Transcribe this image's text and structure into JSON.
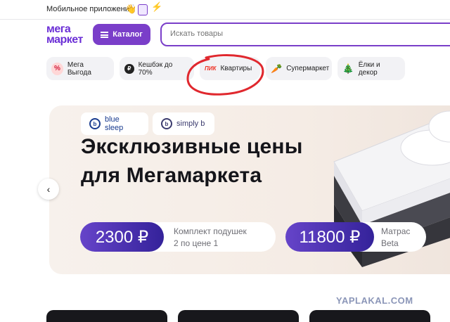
{
  "topbar": {
    "mobile_app_label": "Мобильное приложение",
    "icons": [
      "sparkle-hand-icon",
      "shopping-bag-icon",
      "lightning-icon"
    ]
  },
  "header": {
    "logo_line1": "мега",
    "logo_line2": "маркет",
    "catalog_label": "Каталог",
    "search_placeholder": "Искать товары"
  },
  "chips": [
    {
      "label": "Мега Выгода",
      "icon": "percent-icon",
      "icon_glyph": "%"
    },
    {
      "label": "Кешбэк до 70%",
      "icon": "cashback-icon",
      "icon_glyph": "₽"
    },
    {
      "label": "Квартиры",
      "icon": "pik-logo",
      "icon_glyph": "ПИК"
    },
    {
      "label": "Супермаркет",
      "icon": "carrot-icon",
      "icon_glyph": "🥕"
    },
    {
      "label": "Ёлки и декор",
      "icon": "tree-icon",
      "icon_glyph": "🎄"
    }
  ],
  "banner": {
    "brands": [
      "blue sleep",
      "simply b"
    ],
    "headline_line1": "Эксклюзивные цены",
    "headline_line2": "для Мегамаркета",
    "offers": [
      {
        "price": "2300 ₽",
        "desc_line1": "Комплект подушек",
        "desc_line2": "2 по цене 1"
      },
      {
        "price": "11800 ₽",
        "desc_line1": "Матрас",
        "desc_line2": "Beta"
      }
    ]
  },
  "watermark": "YAPLAKAL.COM",
  "colors": {
    "brand_purple": "#7a3ec9",
    "annotation_red": "#e0282e",
    "banner_bg": "#f5ece5"
  }
}
